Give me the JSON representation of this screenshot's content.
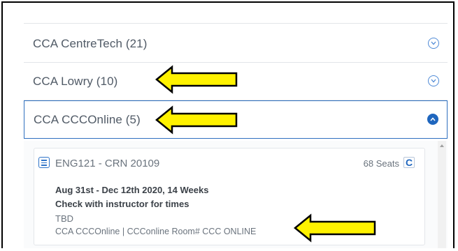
{
  "accordion": [
    {
      "label": "CCA CentreTech (21)",
      "state": "collapsed"
    },
    {
      "label": "CCA Lowry (10)",
      "state": "collapsed"
    },
    {
      "label": "CCA CCCOnline (5)",
      "state": "expanded"
    }
  ],
  "section": {
    "course": "ENG121 - CRN 20109",
    "seats": "68 Seats",
    "dates": "Aug 31st - Dec 12th 2020, 14 Weeks",
    "times": "Check with instructor for times",
    "instructor": "TBD",
    "location": "CCA CCCOnline | CCConline Room# CCC ONLINE"
  },
  "icons": {
    "chevron": "chevron-down-icon",
    "chevron_open": "chevron-up-icon",
    "menu": "menu-icon",
    "refresh": "refresh-icon",
    "annotation": "arrow-annotation"
  },
  "colors": {
    "accent": "#1f66be",
    "arrow_fill": "#fff200",
    "text": "#505a66"
  }
}
